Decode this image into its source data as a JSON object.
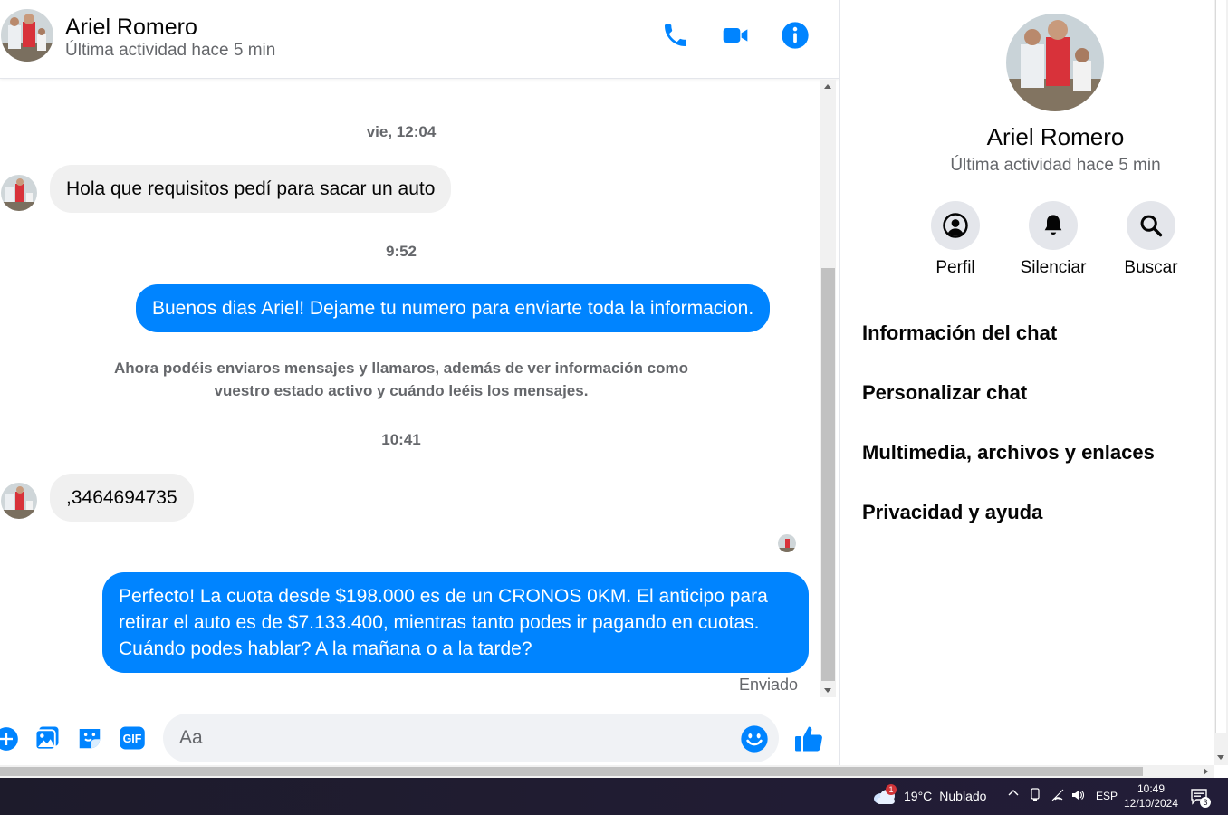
{
  "header": {
    "name": "Ariel Romero",
    "status": "Última actividad hace 5 min",
    "icons": [
      "phone-icon",
      "video-camera-icon",
      "info-icon"
    ]
  },
  "messages": {
    "ts1": "vie, 12:04",
    "msg1": "Hola que requisitos pedí para sacar un auto",
    "ts2": "9:52",
    "msg2": "Buenos dias Ariel! Dejame tu numero para enviarte toda la informacion.",
    "system_note": "Ahora podéis enviaros mensajes y llamaros, además de ver información como vuestro estado activo y cuándo leéis los mensajes.",
    "ts3": "10:41",
    "msg3": ",3464694735",
    "msg4": "Perfecto! La cuota desde $198.000 es de un CRONOS 0KM. El anticipo para retirar el auto es de $7.133.400, mientras tanto podes ir pagando en cuotas. Cuándo podes hablar? A la mañana o a la tarde?",
    "sent_label": "Enviado"
  },
  "composer": {
    "placeholder": "Aa",
    "icons": [
      "plus-icon",
      "photo-icon",
      "sticker-icon",
      "gif-icon",
      "emoji-icon",
      "thumbs-up-icon"
    ],
    "gif_label": "GIF"
  },
  "info": {
    "name": "Ariel Romero",
    "status": "Última actividad hace 5 min",
    "actions": {
      "profile": "Perfil",
      "mute": "Silenciar",
      "search": "Buscar"
    },
    "menu": {
      "chat_info": "Información del chat",
      "customize": "Personalizar chat",
      "media": "Multimedia, archivos y enlaces",
      "privacy": "Privacidad y ayuda"
    }
  },
  "taskbar": {
    "weather_temp": "19°C",
    "weather_desc": "Nublado",
    "weather_badge": "1",
    "language": "ESP",
    "time": "10:49",
    "date": "12/10/2024",
    "notif_count": "3"
  },
  "colors": {
    "accent": "#0084ff",
    "bubble_in": "#f0f0f0",
    "muted_text": "#65676b"
  }
}
